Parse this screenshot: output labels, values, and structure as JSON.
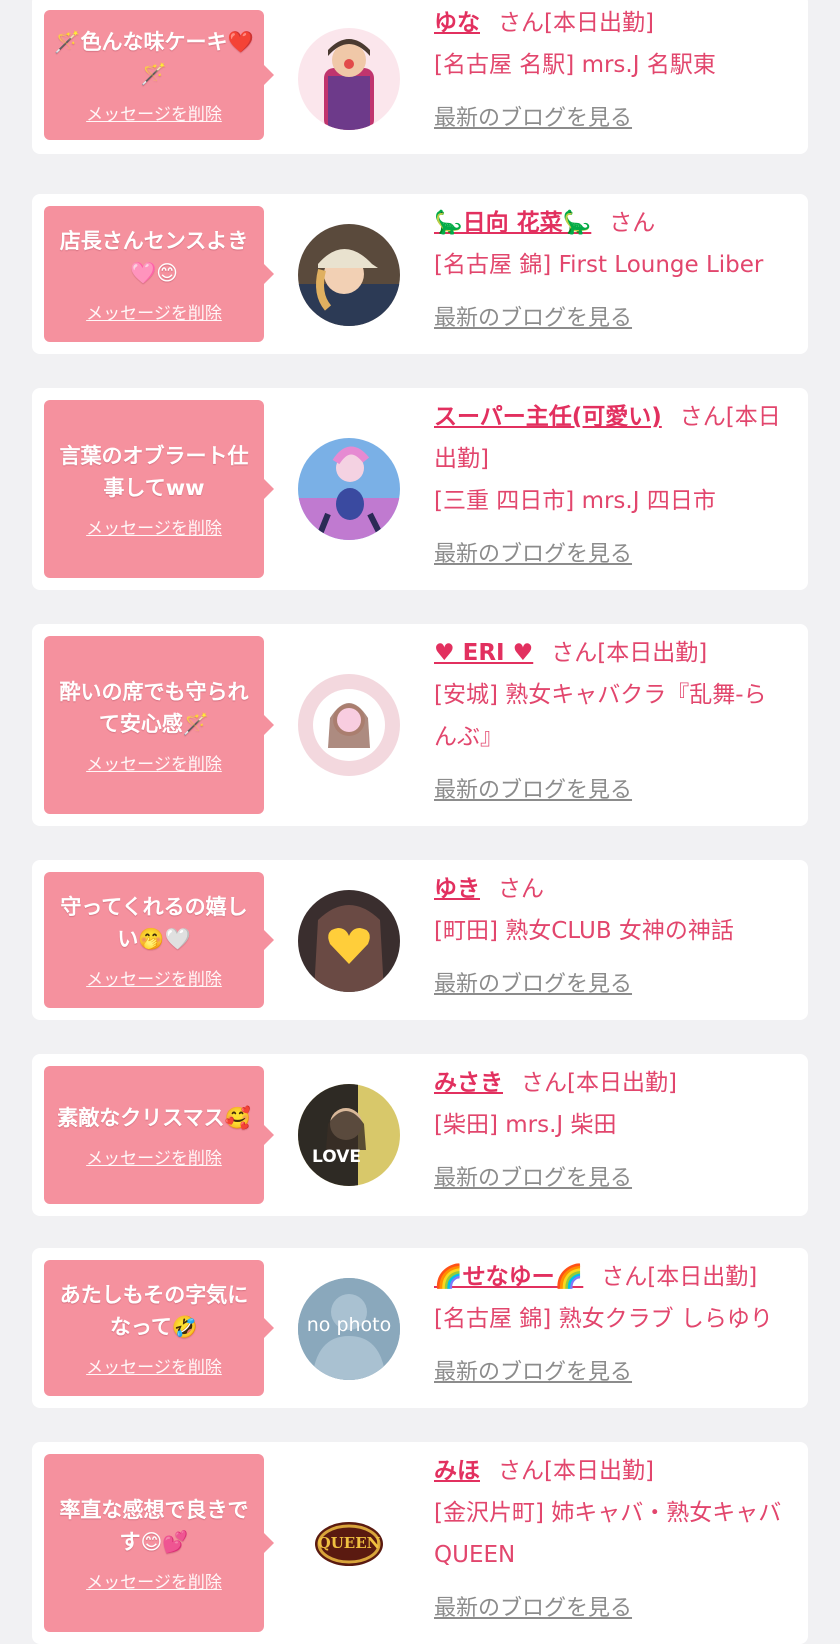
{
  "delete_label": "メッセージを削除",
  "blog_label": "最新のブログを見る",
  "colors": {
    "bubble": "#f5919e",
    "name": "#e2305f",
    "shop": "#e2466d",
    "blog": "#8c8c8c",
    "background": "#f1f1f3"
  },
  "cards": [
    {
      "message": "🪄色んな味ケーキ❤️🪄",
      "name": "ゆな",
      "suffix": "さん[本日出勤]",
      "shop": "[名古屋 名駅] mrs.J 名駅東",
      "avatar": "photo-woman-icon"
    },
    {
      "message": "店長さんセンスよき🩷😊",
      "name": "🦕日向 花菜🦕",
      "suffix": "さん",
      "shop": "[名古屋 錦] First Lounge Liber",
      "avatar": "photo-woman-cap-icon"
    },
    {
      "message": "言葉のオブラート仕事してww",
      "name": "スーパー主任(可愛い)",
      "suffix": "さん[本日出勤]",
      "shop": "[三重 四日市] mrs.J 四日市",
      "avatar": "photo-anime-icon"
    },
    {
      "message": "酔いの席でも守られて安心感🪄",
      "name": "♥ ERI ♥",
      "suffix": "さん[本日出勤]",
      "shop": "[安城] 熟女キャバクラ『乱舞-らんぶ』",
      "avatar": "photo-frame-icon"
    },
    {
      "message": "守ってくれるの嬉しい🤭🤍",
      "name": "ゆき",
      "suffix": "さん",
      "shop": "[町田] 熟女CLUB 女神の神話",
      "avatar": "photo-heart-icon"
    },
    {
      "message": "素敵なクリスマス🥰",
      "name": "みさき",
      "suffix": "さん[本日出勤]",
      "shop": "[柴田] mrs.J 柴田",
      "avatar": "photo-love-icon"
    },
    {
      "message": "あたしもその字気になって🤣",
      "name": "🌈せなゆー🌈",
      "suffix": "さん[本日出勤]",
      "shop": "[名古屋 錦] 熟女クラブ しらゆり",
      "avatar": "no-photo-icon",
      "no_photo_text": "no photo"
    },
    {
      "message": "率直な感想で良きです😊💕",
      "name": "みほ",
      "suffix": "さん[本日出勤]",
      "shop": "[金沢片町] 姉キャバ・熟女キャバ QUEEN",
      "avatar": "queen-logo-icon",
      "logo_text": "QUEEN"
    }
  ]
}
